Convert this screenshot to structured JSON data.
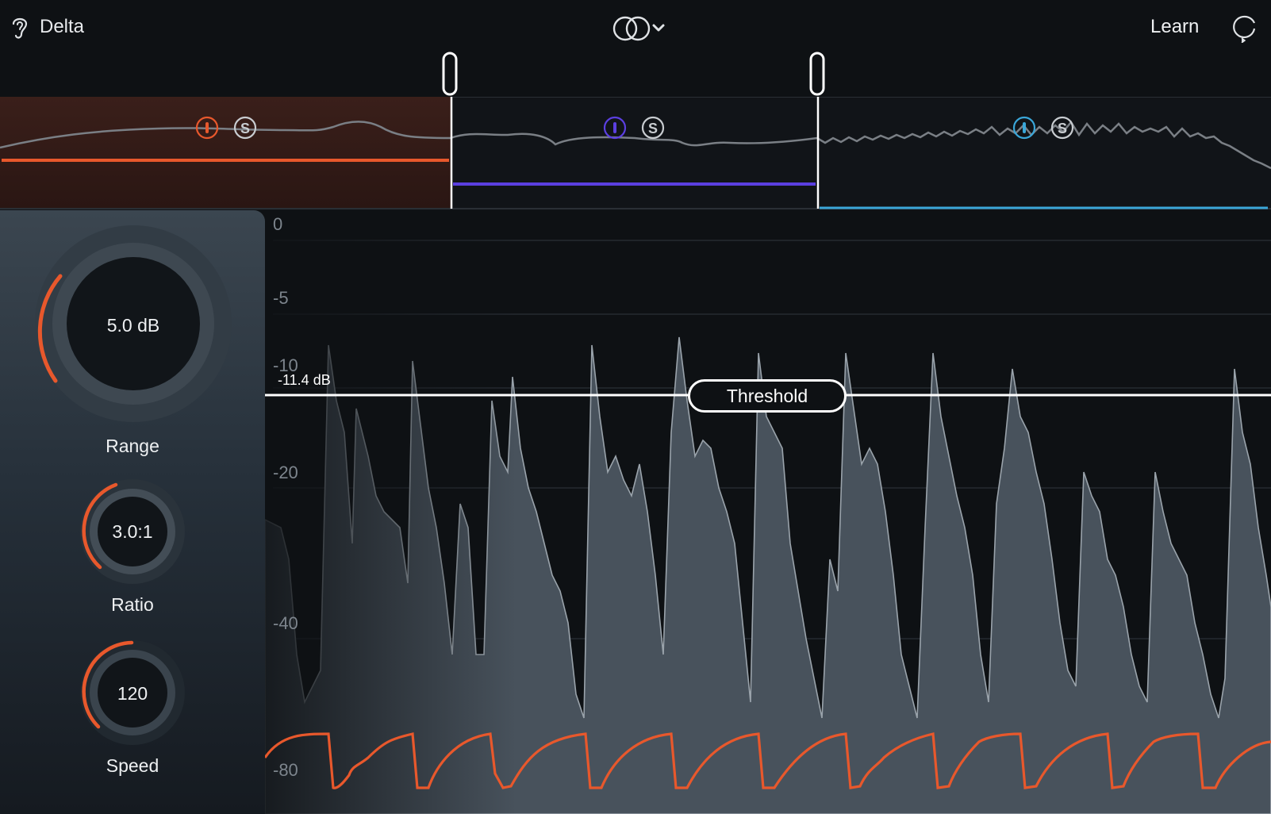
{
  "header": {
    "title": "Delta",
    "learn_label": "Learn",
    "icons": {
      "ear": "ear-icon",
      "mode": "stereo-link-icon",
      "chevron": "chevron-down-icon",
      "refresh": "refresh-icon"
    }
  },
  "bands": [
    {
      "name": "low",
      "color": "#e8582c",
      "solo_label": "S"
    },
    {
      "name": "mid",
      "color": "#5b3fe0",
      "solo_label": "S"
    },
    {
      "name": "high",
      "color": "#3aa6d8",
      "solo_label": "S"
    }
  ],
  "controls": {
    "range": {
      "label": "Range",
      "value": "5.0 dB"
    },
    "ratio": {
      "label": "Ratio",
      "value": "3.0:1"
    },
    "speed": {
      "label": "Speed",
      "value": "120"
    }
  },
  "graph": {
    "threshold_label": "Threshold",
    "threshold_value": "-11.4 dB",
    "y_labels": [
      "0",
      "-5",
      "-10",
      "-20",
      "-40",
      "-80"
    ]
  },
  "colors": {
    "accent": "#e8582c",
    "background": "#0e1114"
  }
}
